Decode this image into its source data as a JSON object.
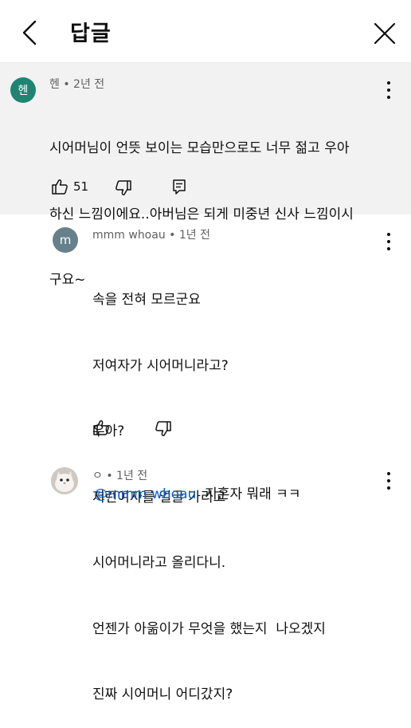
{
  "header": {
    "title": "답글"
  },
  "top_comment": {
    "avatar_letter": "헨",
    "meta": "헨 • 2년 전",
    "lines": [
      "시어머님이 언뜻 보이는 모습만으로도 너무 젊고 우아",
      "하신 느낌이에요..아버님은 되게 미중년 신사 느낌이시",
      "구요~"
    ],
    "like_count": "51"
  },
  "reply1": {
    "avatar_letter": "m",
    "meta": "mmm whoau • 1년 전",
    "lines": [
      "속을 전혀 모르군요",
      "저여자가 시어머니라고?",
      "우아?",
      "저런여자를 얼굴 가리고",
      "시어머니라고 올리다니.",
      "언젠가 아욺이가 무엇을 했는지  나오겠지",
      "진짜 시어머니 어디갔지?"
    ]
  },
  "reply2": {
    "meta": "ㅇ • 1년 전",
    "mention": "@mmm whoau",
    "text": "  지혼자 뭐래 ㅋㅋ"
  },
  "colors": {
    "accent_link": "#065fd4",
    "top_bg": "#f2f2f2",
    "avatar_h": "#1e8573",
    "avatar_m": "#66808c"
  }
}
